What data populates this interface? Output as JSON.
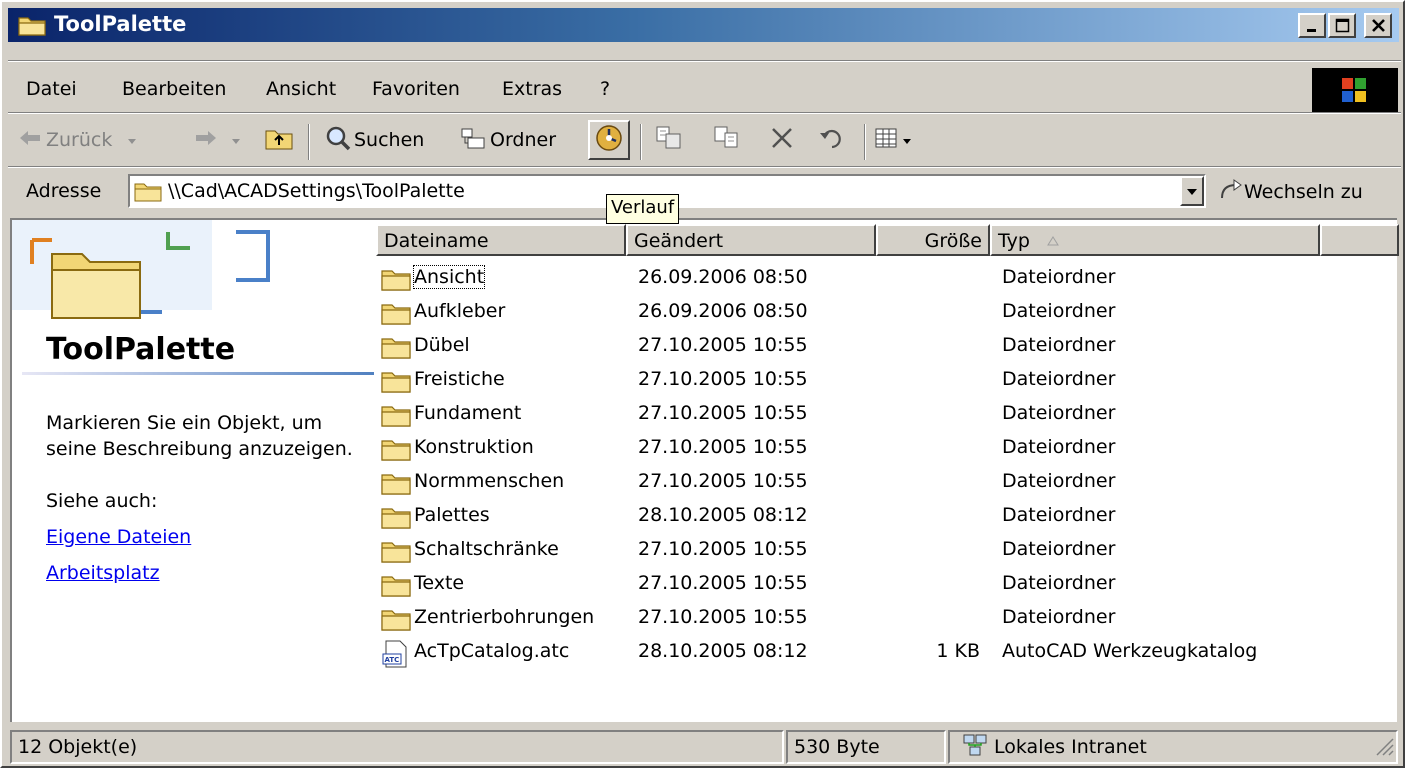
{
  "window": {
    "title": "ToolPalette"
  },
  "menu": [
    "Datei",
    "Bearbeiten",
    "Ansicht",
    "Favoriten",
    "Extras",
    "?"
  ],
  "toolbar": {
    "back": "Zurück",
    "search": "Suchen",
    "folders": "Ordner",
    "history_tooltip": "Verlauf"
  },
  "address": {
    "label": "Adresse",
    "path": "\\\\Cad\\ACADSettings\\ToolPalette",
    "go": "Wechseln zu"
  },
  "left_panel": {
    "title": "ToolPalette",
    "description": "Markieren Sie ein Objekt, um seine Beschreibung anzuzeigen.",
    "see_also": "Siehe auch:",
    "links": [
      "Eigene Dateien",
      "Arbeitsplatz"
    ]
  },
  "columns": {
    "name": "Dateiname",
    "modified": "Geändert",
    "size": "Größe",
    "type": "Typ"
  },
  "files": [
    {
      "name": "Ansicht",
      "modified": "26.09.2006 08:50",
      "size": "",
      "type": "Dateiordner",
      "icon": "folder-icon"
    },
    {
      "name": "Aufkleber",
      "modified": "26.09.2006 08:50",
      "size": "",
      "type": "Dateiordner",
      "icon": "folder-icon"
    },
    {
      "name": "Dübel",
      "modified": "27.10.2005 10:55",
      "size": "",
      "type": "Dateiordner",
      "icon": "folder-icon"
    },
    {
      "name": "Freistiche",
      "modified": "27.10.2005 10:55",
      "size": "",
      "type": "Dateiordner",
      "icon": "folder-icon"
    },
    {
      "name": "Fundament",
      "modified": "27.10.2005 10:55",
      "size": "",
      "type": "Dateiordner",
      "icon": "folder-icon"
    },
    {
      "name": "Konstruktion",
      "modified": "27.10.2005 10:55",
      "size": "",
      "type": "Dateiordner",
      "icon": "folder-icon"
    },
    {
      "name": "Normmenschen",
      "modified": "27.10.2005 10:55",
      "size": "",
      "type": "Dateiordner",
      "icon": "folder-icon"
    },
    {
      "name": "Palettes",
      "modified": "28.10.2005 08:12",
      "size": "",
      "type": "Dateiordner",
      "icon": "folder-icon"
    },
    {
      "name": "Schaltschränke",
      "modified": "27.10.2005 10:55",
      "size": "",
      "type": "Dateiordner",
      "icon": "folder-icon"
    },
    {
      "name": "Texte",
      "modified": "27.10.2005 10:55",
      "size": "",
      "type": "Dateiordner",
      "icon": "folder-icon"
    },
    {
      "name": "Zentrierbohrungen",
      "modified": "27.10.2005 10:55",
      "size": "",
      "type": "Dateiordner",
      "icon": "folder-icon"
    },
    {
      "name": "AcTpCatalog.atc",
      "modified": "28.10.2005 08:12",
      "size": "1 KB",
      "type": "AutoCAD Werkzeugkatalog",
      "icon": "atc-file-icon"
    }
  ],
  "status": {
    "objects": "12 Objekt(e)",
    "size": "530 Byte",
    "zone": "Lokales Intranet"
  },
  "colors": {
    "titlebar_start": "#0a246a",
    "titlebar_end": "#a6caf0",
    "face": "#d4d0c8",
    "link": "#0000ee",
    "tooltip_bg": "#ffffe1"
  }
}
